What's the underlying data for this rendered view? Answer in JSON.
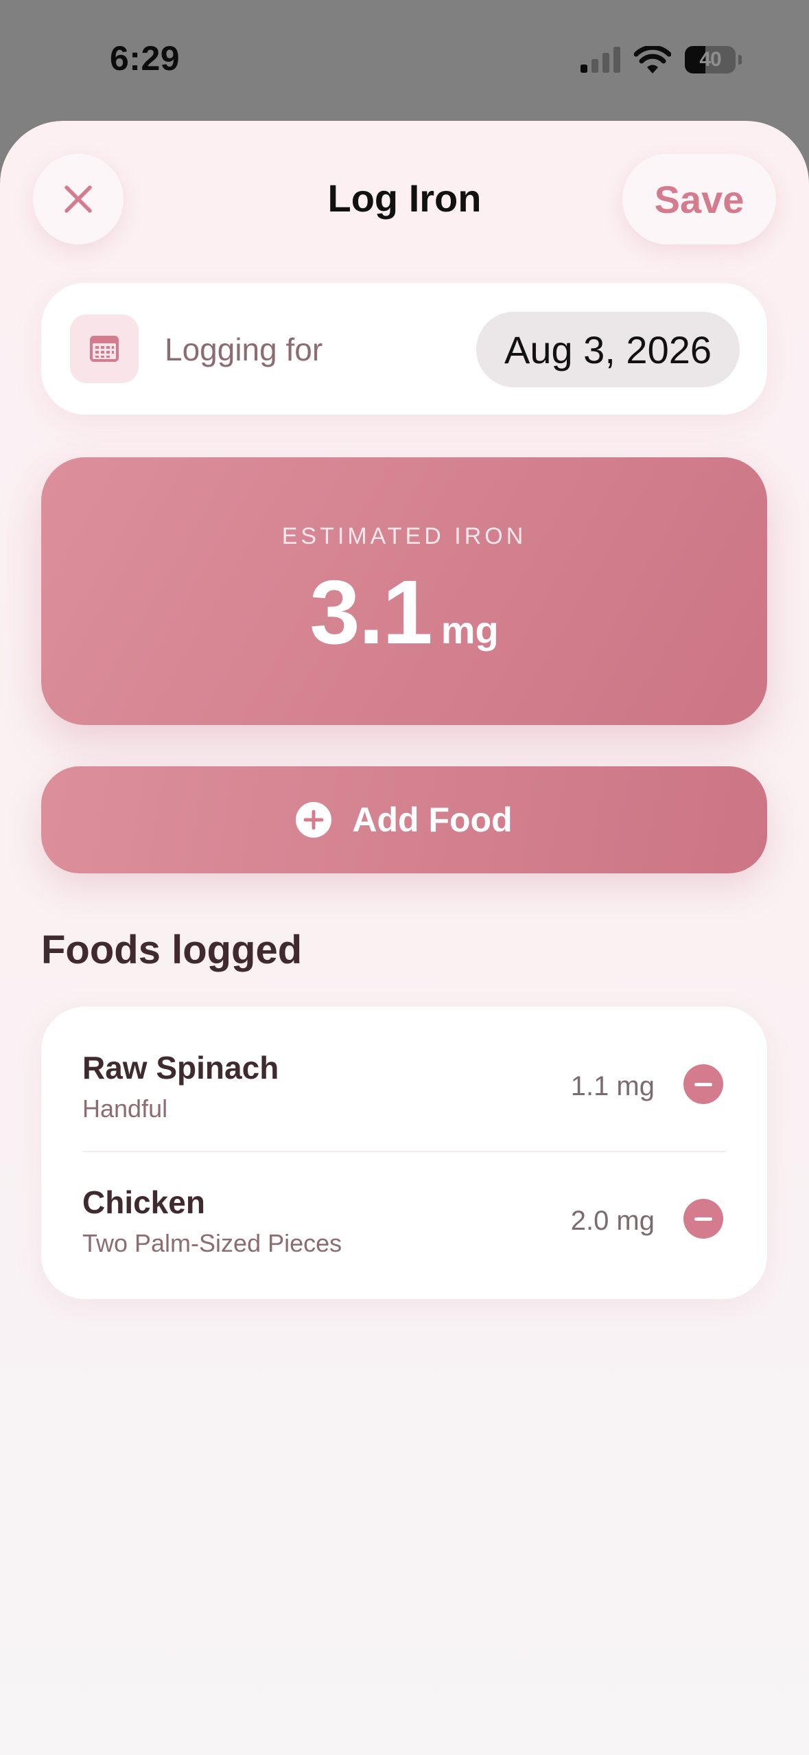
{
  "status_bar": {
    "time": "6:29",
    "battery_level": "40",
    "battery_fraction": 0.4
  },
  "nav": {
    "title": "Log Iron",
    "save_label": "Save",
    "close_icon": "close-icon"
  },
  "date_row": {
    "label": "Logging for",
    "date": "Aug 3, 2026",
    "icon": "calendar-icon"
  },
  "estimate": {
    "label": "ESTIMATED IRON",
    "value": "3.1",
    "unit": "mg"
  },
  "add_food": {
    "label": "Add Food",
    "icon": "plus-circle-icon"
  },
  "foods_logged": {
    "title": "Foods logged",
    "items": [
      {
        "name": "Raw Spinach",
        "portion": "Handful",
        "amount": "1.1 mg"
      },
      {
        "name": "Chicken",
        "portion": "Two Palm-Sized Pieces",
        "amount": "2.0 mg"
      }
    ]
  },
  "colors": {
    "accent": "#d47b8d",
    "gradient_start": "#dc8f9b",
    "gradient_end": "#cc7585",
    "text_dark": "#3e2a2f",
    "text_muted": "#8c6c73"
  }
}
